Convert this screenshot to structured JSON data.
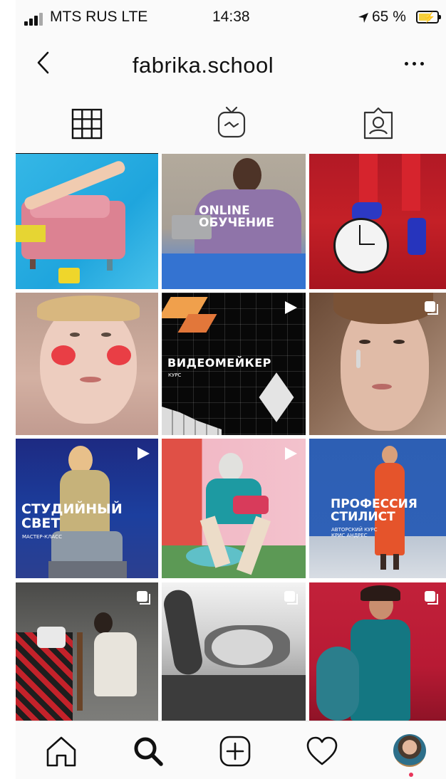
{
  "status_bar": {
    "carrier": "MTS RUS LTE",
    "time": "14:38",
    "battery": "65 %",
    "battery_level": 0.65
  },
  "header": {
    "title": "fabrika.school",
    "back_icon": "chevron-left-icon",
    "more_icon": "more-horizontal-icon"
  },
  "tabs": [
    {
      "icon": "grid-icon",
      "active": true
    },
    {
      "icon": "igtv-icon",
      "active": false
    },
    {
      "icon": "tagged-icon",
      "active": false
    }
  ],
  "posts": [
    {
      "caption": "",
      "indicator": ""
    },
    {
      "caption": "ONLINE\nОБУЧЕНИЕ",
      "indicator": ""
    },
    {
      "caption": "",
      "indicator": ""
    },
    {
      "caption": "",
      "indicator": ""
    },
    {
      "caption": "ВИДЕОМЕЙКЕР",
      "subcaption": "КУРС",
      "indicator": "play"
    },
    {
      "caption": "",
      "indicator": "carousel"
    },
    {
      "caption": "СТУДИЙНЫЙ\nСВЕТ",
      "subcaption": "МАСТЕР-КЛАСС",
      "indicator": "play"
    },
    {
      "caption": "",
      "indicator": "play"
    },
    {
      "caption": "ПРОФЕССИЯ\nСТИЛИСТ",
      "subcaption": "АВТОРСКИЙ КУРС\nКРИС АНДРЕС",
      "indicator": ""
    },
    {
      "caption": "",
      "indicator": "carousel"
    },
    {
      "caption": "",
      "indicator": "carousel"
    },
    {
      "caption": "",
      "indicator": "carousel"
    }
  ],
  "bottom_nav": [
    {
      "icon": "home-icon"
    },
    {
      "icon": "search-icon"
    },
    {
      "icon": "new-post-icon"
    },
    {
      "icon": "activity-heart-icon"
    },
    {
      "icon": "profile-avatar-icon"
    }
  ],
  "colors": {
    "background": "#fafafa",
    "text": "#111111",
    "battery_fill": "#f5cf3a",
    "notification": "#e8355a"
  }
}
